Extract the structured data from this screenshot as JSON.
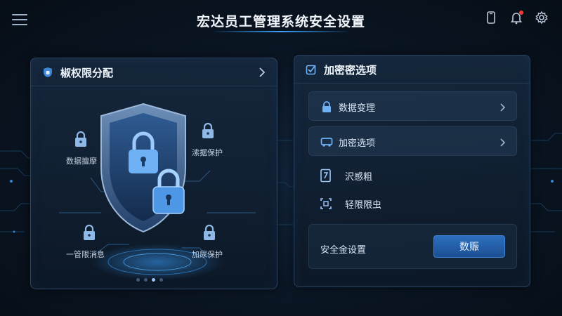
{
  "app": {
    "title": "宏达员工管理系统安全设置"
  },
  "topbar": {
    "menu_icon": "hamburger-menu-icon",
    "icons": [
      "device-icon",
      "bell-icon",
      "gear-icon"
    ],
    "has_notification": true
  },
  "left_panel": {
    "title": "椒权限分配",
    "icon": "shield-badge-icon",
    "labels": {
      "top_left": "数据擅摩",
      "top_right": "溹据保护",
      "bottom_left": "一管限消息",
      "bottom_right": "加尿保护"
    },
    "carousel": {
      "count": 4,
      "active_index": 2
    }
  },
  "right_panel": {
    "title": "加密密选项",
    "icon": "checkbox-edit-icon",
    "rows": [
      {
        "label": "数据变理",
        "icon": "lock-icon"
      },
      {
        "label": "加密选项",
        "icon": "vehicle-icon"
      }
    ],
    "items": [
      {
        "label": "沢感粗",
        "icon": "document-icon"
      },
      {
        "label": "轻限限虫",
        "icon": "scan-icon"
      }
    ],
    "setting": {
      "label": "安全金设置",
      "button": "数赈"
    }
  },
  "colors": {
    "accent": "#2b6fbf",
    "background": "#0a1522",
    "panel_border": "#2b4563"
  }
}
